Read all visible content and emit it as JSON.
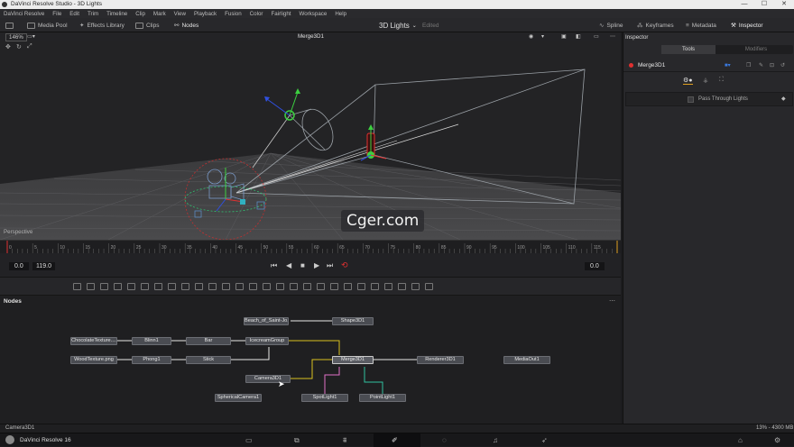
{
  "window": {
    "title": "DaVinci Resolve Studio - 3D Lights",
    "min": "—",
    "max": "☐",
    "close": "✕"
  },
  "menu": [
    "DaVinci Resolve",
    "File",
    "Edit",
    "Trim",
    "Timeline",
    "Clip",
    "Mark",
    "View",
    "Playback",
    "Fusion",
    "Color",
    "Fairlight",
    "Workspace",
    "Help"
  ],
  "toolbar": {
    "media_pool": "Media Pool",
    "effects_library": "Effects Library",
    "clips": "Clips",
    "nodes": "Nodes",
    "project_title": "3D Lights",
    "edited": "Edited",
    "spline": "Spline",
    "keyframes": "Keyframes",
    "metadata": "Metadata",
    "inspector": "Inspector"
  },
  "viewer": {
    "zoom": "146%",
    "title": "Merge3D1",
    "view_label": "Perspective"
  },
  "ruler": {
    "ticks": [
      "0",
      "5",
      "10",
      "15",
      "20",
      "25",
      "30",
      "35",
      "40",
      "45",
      "50",
      "55",
      "60",
      "65",
      "70",
      "75",
      "80",
      "85",
      "90",
      "95",
      "100",
      "105",
      "110",
      "115"
    ]
  },
  "transport": {
    "current": "0.0",
    "end": "119.0",
    "timecode": "0.0"
  },
  "nodes_panel": {
    "title": "Nodes",
    "nodes": {
      "beach": "Beach_of_Saint-Jo...",
      "shape3d": "Shape3D1",
      "chocolate": "ChocolateTexture....",
      "blinn": "Blinn1",
      "bar": "Bar",
      "icecream": "IcecreamGroup",
      "wood": "WoodTexture.png",
      "phong": "Phong1",
      "stick": "Stick",
      "merge3d": "Merge3D1",
      "renderer": "Renderer3D1",
      "mediaout": "MediaOut1",
      "camera": "Camera3D1",
      "spherical": "SphericalCamera1",
      "spotlight": "SpotLight1",
      "pointlight": "PointLight1"
    }
  },
  "inspector": {
    "title": "Inspector",
    "tab_tools": "Tools",
    "tab_modifiers": "Modifiers",
    "node_name": "Merge3D1",
    "pass_through": "Pass Through Lights"
  },
  "status": {
    "left": "Camera3D1",
    "right": "13% - 4300 MB"
  },
  "pagebar": {
    "app": "DaVinci Resolve 16"
  },
  "watermark": "Cger.com",
  "colors": {
    "accent": "#e0a020",
    "record": "#e03030",
    "wire_yellow": "#d8c020",
    "wire_pink": "#e070c8",
    "wire_teal": "#30c0a0",
    "wire_white": "#e8e8e8"
  }
}
